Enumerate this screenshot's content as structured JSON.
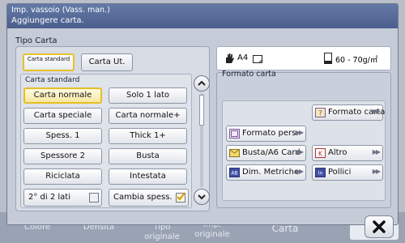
{
  "background": {
    "tabs": [
      "Colore",
      "Densità",
      "Tipo originale",
      "Imp. originale",
      "Carta"
    ]
  },
  "dialog": {
    "title": "Imp. vassoio (Vass. man.)",
    "message": "Aggiungere carta."
  },
  "paper_type": {
    "section_label": "Tipo Carta",
    "tabs": [
      "Carta standard",
      "Carta Ut."
    ],
    "active_tab": "Carta standard",
    "group_label": "Carta standard",
    "buttons": [
      "Carta normale",
      "Solo 1 lato",
      "Carta speciale",
      "Carta normale+",
      "Spess. 1",
      "Thick 1+",
      "Spessore 2",
      "Busta",
      "Riciclata",
      "Intestata"
    ],
    "selected": "Carta normale",
    "options": [
      {
        "label": "2° di 2 lati",
        "checked": false
      },
      {
        "label": "Cambia spess.",
        "checked": true
      }
    ]
  },
  "status": {
    "size": "A4",
    "weight": "60 - 70g/㎡"
  },
  "paper_format": {
    "section_label": "Formato carta",
    "buttons": [
      "Formato carta",
      "Formato pers.",
      "Busta/A6 Card",
      "Altro",
      "Dim. Metriche",
      "Pollici"
    ]
  },
  "colors": {
    "title_bar": "#4b5f8d",
    "selected_border": "#e6be27",
    "panel": "#d7dce5"
  }
}
